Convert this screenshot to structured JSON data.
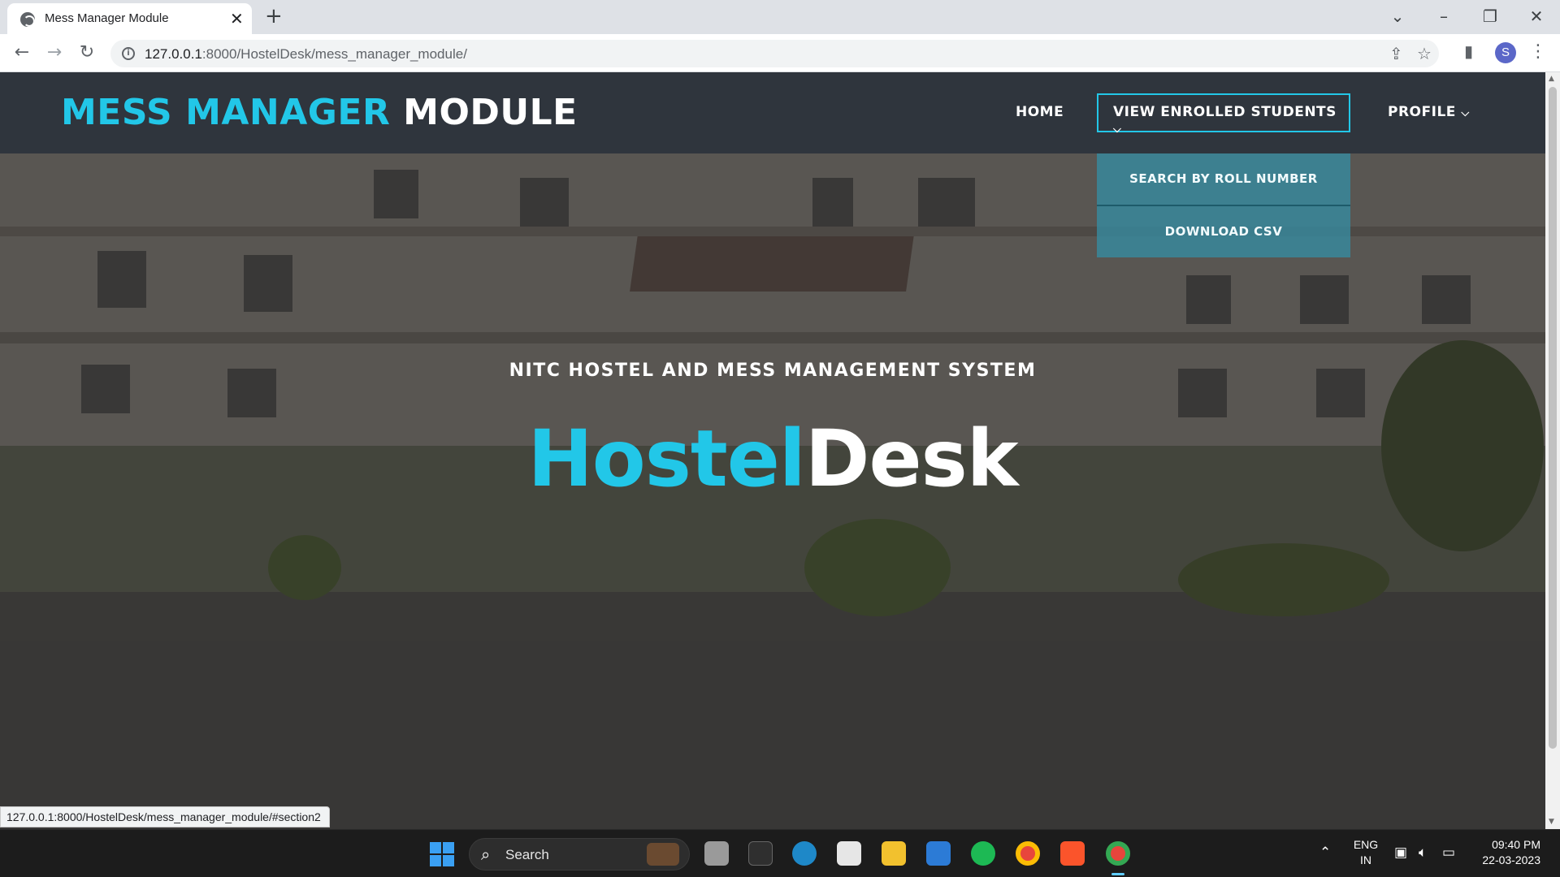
{
  "browser": {
    "tab_title": "Mess Manager Module",
    "tab_close": "✕",
    "new_tab": "+",
    "url_host": "127.0.0.1",
    "url_rest": ":8000/HostelDesk/mess_manager_module/",
    "profile_initial": "S"
  },
  "navbar": {
    "brand_accent": "MESS MANAGER",
    "brand_plain": "MODULE",
    "links": {
      "home": "HOME",
      "view_enrolled": "VIEW ENROLLED STUDENTS",
      "profile": "PROFILE"
    },
    "dropdown": {
      "search_by_roll": "SEARCH BY ROLL NUMBER",
      "download_csv": "DOWNLOAD CSV"
    }
  },
  "hero": {
    "subtitle": "NITC HOSTEL AND MESS MANAGEMENT SYSTEM",
    "title_accent": "Hostel",
    "title_plain": "Desk"
  },
  "status_bar": {
    "hover_url": "127.0.0.1:8000/HostelDesk/mess_manager_module/#section2"
  },
  "taskbar": {
    "search_placeholder": "Search",
    "language": "ENG",
    "region": "IN",
    "time": "09:40 PM",
    "date": "22-03-2023"
  },
  "colors": {
    "accent": "#22c7e8",
    "navbar_bg": "#2f353d",
    "dropdown_bg": "#368ca2"
  },
  "icons": [
    "globe-icon",
    "close-icon",
    "plus-icon",
    "back-arrow-icon",
    "forward-arrow-icon",
    "reload-icon",
    "info-icon",
    "share-icon",
    "star-icon",
    "sidepanel-icon",
    "menu-dots-icon",
    "chevron-down-icon",
    "windows-start-icon",
    "search-icon",
    "wifi-icon",
    "volume-icon",
    "battery-icon"
  ]
}
